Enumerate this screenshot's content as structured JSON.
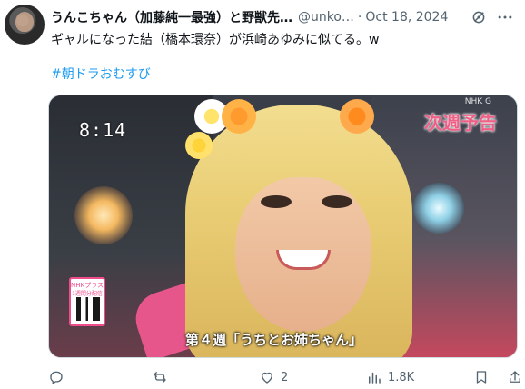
{
  "tweet": {
    "author_name": "うんこちゃん（加藤純一最強）と野獣先…",
    "handle": "@unko…",
    "separator": "·",
    "date": "Oct 18, 2024",
    "text": "ギャルになった結（橋本環奈）が浜崎あゆみに似てる。w",
    "hashtag": "#朝ドラおむすび"
  },
  "media": {
    "timestamp": "8:14",
    "overlay_title": "次週予告",
    "channel_mark": "NHK G",
    "qr_label_top": "NHKプラス",
    "qr_label_bottom": "1週間分配信",
    "subtitle": "第４週「うちとお姉ちゃん」"
  },
  "actions": {
    "replies": "",
    "reposts": "",
    "likes": "2",
    "views": "1.8K"
  },
  "colors": {
    "link": "#1d9bf0",
    "muted": "#536471",
    "text": "#0f1419"
  }
}
